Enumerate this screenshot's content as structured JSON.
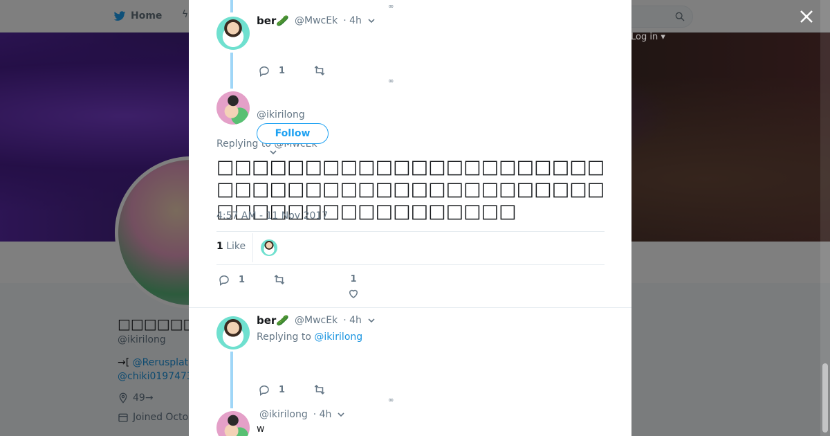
{
  "background": {
    "nav_home": "Home",
    "login": "Log in ▾",
    "profile_name": "□□□□□□",
    "profile_handle": "@ikirilong",
    "bio_prefix": "→[ ",
    "bio_mention_1": "@Rerusplat",
    "bio_mention_2": "@chiki0197473",
    "location": "49→",
    "joined": "Joined Octo"
  },
  "thread": {
    "tweet1": {
      "name": "ber🥒",
      "handle": "@MwcEk",
      "time": "· 4h",
      "reply_count": "1",
      "more_dots": "∞"
    },
    "focused": {
      "handle": "@ikirilong",
      "follow_label": "Follow",
      "replying_to_prefix": "Replying to ",
      "replying_to_handle": "@MwcEk",
      "text": "□□□□□□□□□□□□□□□□□□□□□□□□□□□□□□□□□□□□□□□□□□□□□□□□□□□□□□□□□□□□□",
      "timestamp": "4:57 AM - 11 Nov 2017",
      "likes_count": "1",
      "likes_label": " Like",
      "reply_count": "1",
      "like_count_action": "1"
    },
    "tweet3": {
      "name": "ber🥒",
      "handle": "@MwcEk",
      "time": "· 4h",
      "replying_to_prefix": "Replying to ",
      "replying_to_handle": "@ikirilong",
      "reply_count": "1",
      "more_dots": "∞"
    },
    "tweet4": {
      "handle": "@ikirilong",
      "time": "· 4h",
      "text": "w"
    }
  },
  "colors": {
    "accent": "#1da1f2",
    "link": "#1b95e0",
    "thread_line": "#9fd6f7"
  }
}
